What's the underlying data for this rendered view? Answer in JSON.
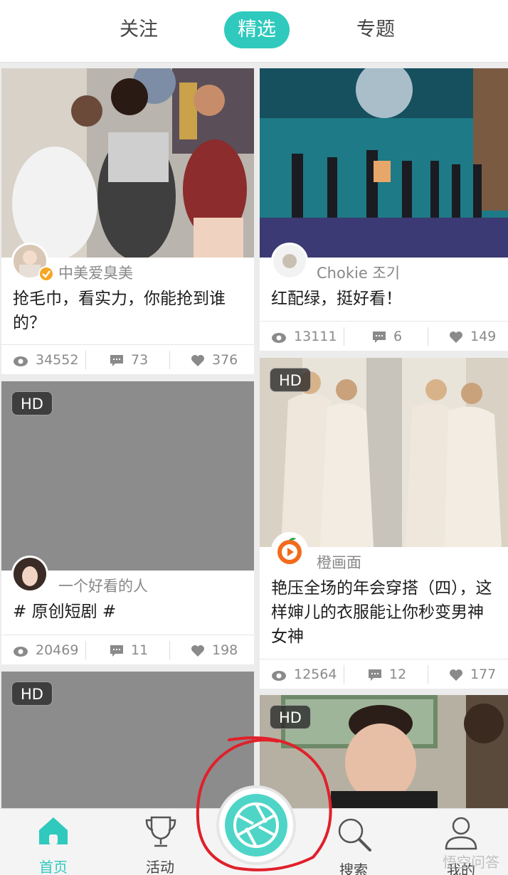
{
  "tabs": [
    {
      "label": "关注",
      "active": false
    },
    {
      "label": "精选",
      "active": true
    },
    {
      "label": "专题",
      "active": false
    }
  ],
  "accent_color": "#2fc9bd",
  "cards": [
    {
      "hd": null,
      "author": "中美爱臭美",
      "verified": true,
      "title": "抢毛巾，看实力，你能抢到谁的？",
      "views": "34552",
      "comments": "73",
      "likes": "376"
    },
    {
      "hd": null,
      "author": "Chokie 조기",
      "verified": false,
      "title": "红配绿，挺好看！",
      "views": "13111",
      "comments": "6",
      "likes": "149"
    },
    {
      "hd": "HD",
      "author": "一个好看的人",
      "verified": false,
      "title": "# 原创短剧 #",
      "views": "20469",
      "comments": "11",
      "likes": "198"
    },
    {
      "hd": "HD",
      "author": "橙画面",
      "verified": false,
      "title": "艳压全场的年会穿搭（四），这样婶儿的衣服能让你秒变男神女神",
      "views": "12564",
      "comments": "12",
      "likes": "177"
    },
    {
      "hd": "HD"
    },
    {
      "hd": "HD"
    }
  ],
  "bottom_nav": [
    {
      "label": "首页",
      "icon": "home-icon",
      "active": true
    },
    {
      "label": "活动",
      "icon": "trophy-icon",
      "active": false
    },
    {
      "label": "",
      "icon": "camera-shutter-icon",
      "active": false
    },
    {
      "label": "搜索",
      "icon": "search-icon",
      "active": false
    },
    {
      "label": "我的",
      "icon": "user-icon",
      "active": false
    }
  ],
  "watermark": "悟空问答"
}
